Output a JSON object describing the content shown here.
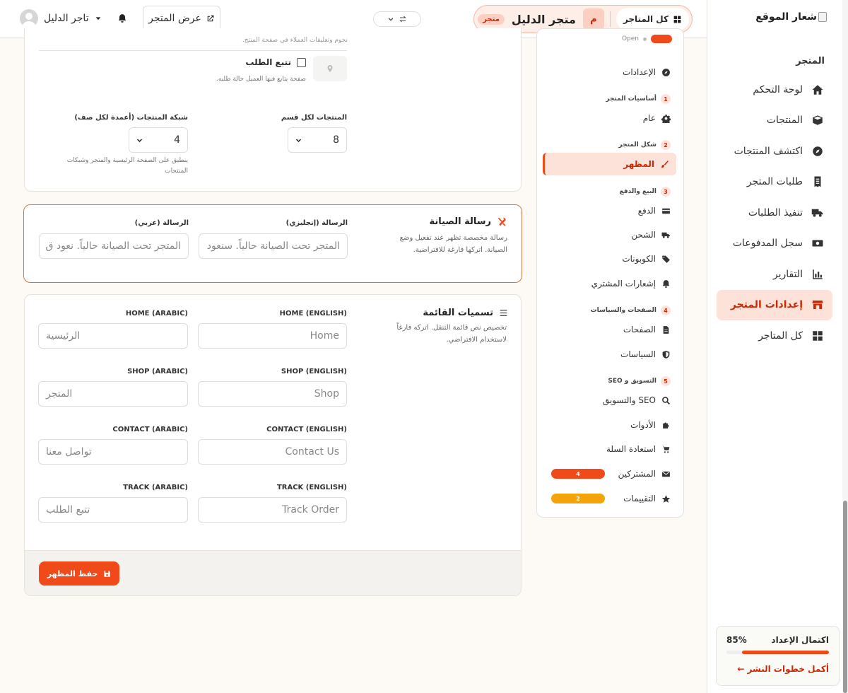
{
  "sidebar": {
    "logo_alt": "شعار الموقع",
    "section_title": "المتجر",
    "items": [
      {
        "label": "لوحة التحكم",
        "icon": "home-icon",
        "active": false
      },
      {
        "label": "المنتجات",
        "icon": "box-icon",
        "active": false
      },
      {
        "label": "اكتشف المنتجات",
        "icon": "compass-icon",
        "active": false
      },
      {
        "label": "طلبات المتجر",
        "icon": "receipt-icon",
        "active": false
      },
      {
        "label": "تنفيذ الطلبات",
        "icon": "truck-icon",
        "active": false
      },
      {
        "label": "سجل المدفوعات",
        "icon": "money-icon",
        "active": false
      },
      {
        "label": "التقارير",
        "icon": "chart-icon",
        "active": false
      },
      {
        "label": "إعدادات المتجر",
        "icon": "store-icon",
        "active": true
      },
      {
        "label": "كل المتاجر",
        "icon": "grid-icon",
        "active": false
      }
    ],
    "progress": {
      "title": "اكتمال الإعداد",
      "percent_text": "85%",
      "percent": 0.85,
      "link": "أكمل خطوات النشر ←"
    }
  },
  "topbar": {
    "all_stores": "كل المتاجر",
    "store_initial": "م",
    "store_name": "متجر الدليل",
    "store_badge": "متجر",
    "view_store": "عرض المتجر",
    "user_name": "تاجر الدليل"
  },
  "settings_nav": {
    "top_status": "Open",
    "settings": "الإعدادات",
    "groups": [
      {
        "num": "1",
        "label": "أساسيات المتجر"
      },
      {
        "num": "2",
        "label": "شكل المتجر"
      },
      {
        "num": "3",
        "label": "البيع والدفع"
      },
      {
        "num": "4",
        "label": "الصفحات والسياسات"
      },
      {
        "num": "5",
        "label": "التسويق و SEO"
      }
    ],
    "items": {
      "general": "عام",
      "appearance": "المظهر",
      "payment": "الدفع",
      "shipping": "الشحن",
      "coupons": "الكوبونات",
      "notifications": "إشعارات المشتري",
      "pages": "الصفحات",
      "policies": "السياسات",
      "seo": "SEO والتسويق",
      "tools": "الأدوات",
      "cart_recovery": "استعادة السلة",
      "subscribers": "المشتركين",
      "reviews": "التقييمات"
    },
    "subscribers_count": "4",
    "reviews_count": "2",
    "colors": {
      "accent": "#f04a1a",
      "reviews": "#f5a30b"
    }
  },
  "card1": {
    "top_note": "نجوم وتعليقات العملاء في صفحة المنتج.",
    "track_order_label": "تتبع الطلب",
    "track_order_note": "صفحة يتابع فيها العميل حالة طلبه.",
    "products_per_section_label": "المنتجات لكل قسم",
    "products_per_section_value": "8",
    "grid_label": "شبكة المنتجات (أعمدة لكل صف)",
    "grid_value": "4",
    "grid_note": "ينطبق على الصفحة الرئيسية والمتجر وشبكات المنتجات"
  },
  "maintenance": {
    "title": "رسالة الصيانة",
    "desc": "رسالة مخصصة تظهر عند تفعيل وضع الصيانة. اتركها فارغة للافتراضية.",
    "en_label": "الرسالة (إنجليزي)",
    "en_placeholder": "المتجر تحت الصيانة حالياً. سنعود",
    "ar_label": "الرسالة (عربي)",
    "ar_placeholder": "المتجر تحت الصيانة حالياً. نعود ق"
  },
  "menu_labels": {
    "title": "تسميات القائمة",
    "desc": "تخصيص نص قائمة التنقل. اتركه فارغاً لاستخدام الافتراضي.",
    "fields": [
      {
        "en_label": "HOME (ENGLISH)",
        "en_placeholder": "Home",
        "ar_label": "HOME (ARABIC)",
        "ar_placeholder": "الرئيسية"
      },
      {
        "en_label": "SHOP (ENGLISH)",
        "en_placeholder": "Shop",
        "ar_label": "SHOP (ARABIC)",
        "ar_placeholder": "المتجر"
      },
      {
        "en_label": "CONTACT (ENGLISH)",
        "en_placeholder": "Contact Us",
        "ar_label": "CONTACT (ARABIC)",
        "ar_placeholder": "تواصل معنا"
      },
      {
        "en_label": "TRACK (ENGLISH)",
        "en_placeholder": "Track Order",
        "ar_label": "TRACK (ARABIC)",
        "ar_placeholder": "تتبع الطلب"
      }
    ],
    "save_label": "حفظ المظهر"
  }
}
